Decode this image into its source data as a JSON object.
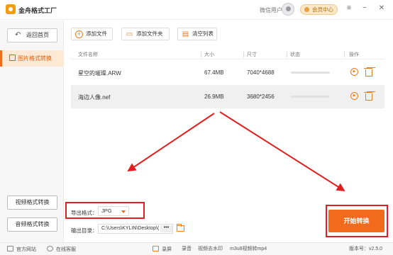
{
  "app": {
    "title": "金舟格式工厂"
  },
  "header": {
    "user_label": "微信用户",
    "vip_label": "会员中心",
    "controls": {
      "menu": "≡",
      "minimize": "−",
      "close": "✕"
    }
  },
  "sidebar": {
    "back_label": "返回首页",
    "active_item": "图片格式转换",
    "bottom_buttons": [
      "视频格式转换",
      "音频格式转换"
    ]
  },
  "toolbar": {
    "add_file": "添加文件",
    "add_folder": "添加文件夹",
    "clear_list": "清空列表"
  },
  "table": {
    "headers": [
      "文件名称",
      "大小",
      "尺寸",
      "状态",
      "操作"
    ],
    "rows": [
      {
        "name": "星空的璀璨.ARW",
        "size": "67.4MB",
        "dimensions": "7040*4688",
        "progress": 0
      },
      {
        "name": "海边人像.nef",
        "size": "26.9MB",
        "dimensions": "3680*2456",
        "progress": 0
      }
    ]
  },
  "output": {
    "format_label": "导出格式：",
    "format_value": "JPG",
    "dir_label": "输出目录：",
    "dir_value": "C:\\Users\\KYLIN\\Desktop\\(",
    "dir_more": "•••"
  },
  "start_button": "开始转换",
  "statusbar": {
    "official_site": "官方网站",
    "support": "在线客服",
    "links": [
      "录屏",
      "录音",
      "视频去水印",
      "m3u8视频转mp4"
    ],
    "version": "版本号：v2.5.0"
  },
  "colors": {
    "accent": "#f26a1b",
    "annotation": "#e02020"
  }
}
